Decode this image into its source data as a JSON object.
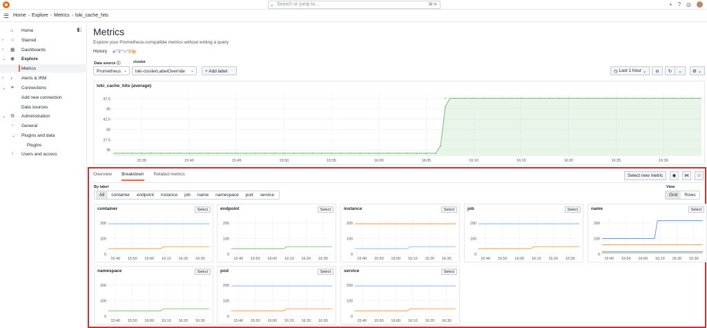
{
  "topbar": {
    "search_placeholder": "Search or jump to...",
    "search_shortcut": "⌘+k",
    "plus_label": "+",
    "help_label": "?",
    "news_label": "◎"
  },
  "breadcrumb": {
    "home": "Home",
    "explore": "Explore",
    "metrics": "Metrics",
    "current": "loki_cache_hits",
    "sep": "›"
  },
  "sidebar": {
    "items": [
      {
        "label": "Home",
        "icon": "home-icon",
        "icon_glyph": "⌂",
        "chev": "",
        "top": 6,
        "left": 31,
        "active": false
      },
      {
        "label": "Starred",
        "icon": "star-icon",
        "icon_glyph": "☆",
        "chev": "›",
        "top": 20,
        "left": 31,
        "active": false
      },
      {
        "label": "Dashboards",
        "icon": "dashboard-icon",
        "icon_glyph": "▦",
        "chev": "›",
        "top": 34,
        "left": 31,
        "active": false
      },
      {
        "label": "Explore",
        "icon": "compass-icon",
        "icon_glyph": "◉",
        "chev": "⌄",
        "top": 47,
        "left": 31,
        "active": false,
        "bold": true
      },
      {
        "label": "Metrics",
        "icon": "",
        "icon_glyph": "",
        "chev": "",
        "top": 61,
        "left": 31,
        "active": true
      },
      {
        "label": "Alerts & IRM",
        "icon": "bell-icon",
        "icon_glyph": "♪",
        "chev": "›",
        "top": 75,
        "left": 31,
        "active": false
      },
      {
        "label": "Connections",
        "icon": "connection-icon",
        "icon_glyph": "⚭",
        "chev": "⌄",
        "top": 89,
        "left": 31,
        "active": false
      },
      {
        "label": "Add new connection",
        "icon": "",
        "icon_glyph": "",
        "chev": "",
        "top": 103,
        "left": 31,
        "active": false
      },
      {
        "label": "Data sources",
        "icon": "",
        "icon_glyph": "",
        "chev": "",
        "top": 117,
        "left": 31,
        "active": false
      },
      {
        "label": "Administration",
        "icon": "gear-icon",
        "icon_glyph": "⚙",
        "chev": "⌄",
        "top": 130,
        "left": 31,
        "active": false
      },
      {
        "label": "General",
        "icon": "",
        "icon_glyph": "",
        "chev": "›",
        "top": 144,
        "left": 31,
        "active": false,
        "subchev": true
      },
      {
        "label": "Plugins and data",
        "icon": "",
        "icon_glyph": "",
        "chev": "⌄",
        "top": 158,
        "left": 31,
        "active": false,
        "subchev": true
      },
      {
        "label": "Plugins",
        "icon": "",
        "icon_glyph": "",
        "chev": "",
        "top": 172,
        "left": 39,
        "active": false
      },
      {
        "label": "Users and access",
        "icon": "",
        "icon_glyph": "",
        "chev": "›",
        "top": 185,
        "left": 31,
        "active": false,
        "subchev": true
      }
    ]
  },
  "header": {
    "title": "Metrics",
    "subtitle": "Explore your Prometheus-compatible metrics without writing a query",
    "history_label": "History"
  },
  "controls": {
    "datasource_label": "Data source",
    "datasource_value": "Prometheus",
    "cluster_label": "cluster",
    "cluster_value": "loki-clusterLabelOverride",
    "add_label": "+ Add label",
    "time_range": "Last 1 hour",
    "clock_glyph": "◷",
    "zoom_glyph": "⊖",
    "refresh_glyph": "↻",
    "dropdown_glyph": "⌄",
    "settings_glyph": "⚙"
  },
  "main_chart": {
    "title": "loki_cache_hits (average)"
  },
  "breakdown": {
    "tabs": [
      "Overview",
      "Breakdown",
      "Related metrics"
    ],
    "active_tab": 1,
    "select_new_metric": "Select new metric",
    "by_label": "By label",
    "labels": [
      "All",
      "container",
      "endpoint",
      "instance",
      "job",
      "name",
      "namespace",
      "pod",
      "service"
    ],
    "view_label": "View",
    "views": [
      "Grid",
      "Rows"
    ],
    "select_label": "Select",
    "panel_titles": [
      "container",
      "endpoint",
      "instance",
      "job",
      "name",
      "namespace",
      "pod",
      "service"
    ]
  },
  "chart_data": [
    {
      "type": "line",
      "title": "loki_cache_hits (average)",
      "x": [
        "15:35",
        "15:40",
        "15:45",
        "15:50",
        "15:55",
        "16:00",
        "16:05",
        "16:10",
        "16:15",
        "16:20",
        "16:25",
        "16:30"
      ],
      "xlim": [
        "15:32",
        "16:34"
      ],
      "ylim": [
        33.5,
        49
      ],
      "yticks": [
        35,
        37.5,
        40,
        42.5,
        45,
        47.5
      ],
      "series": [
        {
          "color": "#73bf69",
          "points": [
            [
              "15:32",
              34.2
            ],
            [
              "16:06",
              34.2
            ],
            [
              "16:06.5",
              36
            ],
            [
              "16:07",
              45.5
            ],
            [
              "16:07.5",
              47.6
            ],
            [
              "16:34",
              47.6
            ]
          ]
        }
      ],
      "grid": true,
      "area": true
    },
    {
      "type": "line",
      "title": "container",
      "xticks": [
        "15:40",
        "15:50",
        "16:00",
        "16:10",
        "16:20",
        "16:30"
      ],
      "yticks": [
        0,
        100,
        200
      ],
      "series": [
        {
          "color": "#8ab8ff",
          "points": [
            [
              0,
              195
            ],
            [
              1,
              195
            ]
          ]
        },
        {
          "color": "#ff9830",
          "points": [
            [
              0,
              35
            ],
            [
              0.52,
              35
            ],
            [
              0.55,
              48
            ],
            [
              1,
              48
            ]
          ]
        }
      ]
    },
    {
      "type": "line",
      "title": "endpoint",
      "xticks": [
        "15:40",
        "15:50",
        "16:00",
        "16:10",
        "16:20",
        "16:30"
      ],
      "yticks": [
        0,
        100,
        200
      ],
      "series": [
        {
          "color": "#73bf69",
          "points": [
            [
              0,
              35
            ],
            [
              0.52,
              35
            ],
            [
              0.55,
              48
            ],
            [
              1,
              48
            ]
          ]
        }
      ]
    },
    {
      "type": "line",
      "title": "instance",
      "xticks": [
        "15:40",
        "15:50",
        "16:00",
        "16:10",
        "16:20",
        "16:30"
      ],
      "yticks": [
        0,
        100,
        200
      ],
      "series": [
        {
          "color": "#ff9830",
          "points": [
            [
              0,
              195
            ],
            [
              1,
              195
            ]
          ]
        },
        {
          "color": "#8ab8ff",
          "points": [
            [
              0,
              35
            ],
            [
              0.52,
              35
            ],
            [
              0.55,
              48
            ],
            [
              1,
              48
            ]
          ]
        }
      ]
    },
    {
      "type": "line",
      "title": "job",
      "xticks": [
        "15:40",
        "15:50",
        "16:00",
        "16:10",
        "16:20",
        "16:30"
      ],
      "yticks": [
        0,
        100,
        200
      ],
      "series": [
        {
          "color": "#8ab8ff",
          "points": [
            [
              0,
              195
            ],
            [
              1,
              195
            ]
          ]
        },
        {
          "color": "#ff9830",
          "points": [
            [
              0,
              35
            ],
            [
              0.52,
              35
            ],
            [
              0.55,
              48
            ],
            [
              1,
              48
            ]
          ]
        }
      ]
    },
    {
      "type": "line",
      "title": "name",
      "xticks": [
        "15:40",
        "15:50",
        "16:00",
        "16:10",
        "16:20",
        "16:30"
      ],
      "yticks": [
        0,
        100,
        200
      ],
      "series": [
        {
          "color": "#5794f2",
          "points": [
            [
              0,
              100
            ],
            [
              0.52,
              100
            ],
            [
              0.55,
              215
            ],
            [
              1,
              215
            ]
          ]
        },
        {
          "color": "#ff9830",
          "points": [
            [
              0,
              60
            ],
            [
              1,
              60
            ]
          ]
        },
        {
          "color": "#b877d9",
          "points": [
            [
              0,
              15
            ],
            [
              1,
              15
            ]
          ]
        },
        {
          "color": "#73bf69",
          "points": [
            [
              0,
              8
            ],
            [
              1,
              8
            ]
          ]
        }
      ]
    },
    {
      "type": "line",
      "title": "namespace",
      "xticks": [
        "15:40",
        "15:50",
        "16:00",
        "16:10",
        "16:20",
        "16:30"
      ],
      "yticks": [
        0,
        100,
        200
      ],
      "series": [
        {
          "color": "#73bf69",
          "points": [
            [
              0,
              35
            ],
            [
              0.52,
              35
            ],
            [
              0.55,
              48
            ],
            [
              1,
              48
            ]
          ]
        }
      ]
    },
    {
      "type": "line",
      "title": "pod",
      "xticks": [
        "15:40",
        "15:50",
        "16:00",
        "16:10",
        "16:20",
        "16:30"
      ],
      "yticks": [
        0,
        100,
        200
      ],
      "series": [
        {
          "color": "#8ab8ff",
          "points": [
            [
              0,
              195
            ],
            [
              1,
              195
            ]
          ]
        },
        {
          "color": "#ff9830",
          "points": [
            [
              0,
              35
            ],
            [
              0.52,
              35
            ],
            [
              0.55,
              48
            ],
            [
              1,
              48
            ]
          ]
        }
      ]
    },
    {
      "type": "line",
      "title": "service",
      "xticks": [
        "15:40",
        "15:50",
        "16:00",
        "16:10",
        "16:20",
        "16:30"
      ],
      "yticks": [
        0,
        100,
        200
      ],
      "series": [
        {
          "color": "#8ab8ff",
          "points": [
            [
              0,
              195
            ],
            [
              1,
              195
            ]
          ]
        },
        {
          "color": "#ff9830",
          "points": [
            [
              0,
              35
            ],
            [
              0.52,
              35
            ],
            [
              0.55,
              48
            ],
            [
              1,
              48
            ]
          ]
        }
      ]
    }
  ],
  "colors": {
    "accent": "#f55f3e",
    "highlight_border": "#d22d2d",
    "grafana_orange": "#f46800"
  }
}
